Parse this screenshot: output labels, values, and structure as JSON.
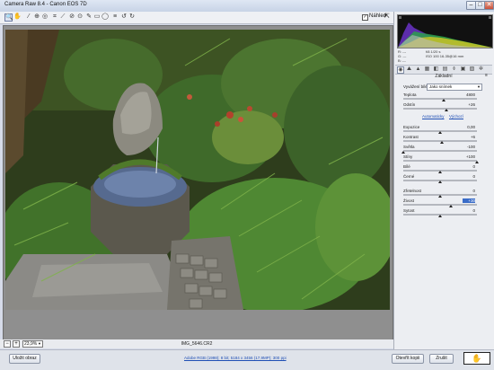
{
  "window": {
    "title": "Camera Raw 8.4  -  Canon EOS 7D"
  },
  "window_controls": {
    "minimize": "–",
    "maximize": "□",
    "close": "✕"
  },
  "toolbar": {
    "tools": [
      "zoom-icon",
      "hand-icon",
      "white-balance-icon",
      "color-sampler-icon",
      "targeted-adjustment-icon",
      "crop-icon",
      "straighten-icon",
      "spot-removal-icon",
      "red-eye-icon",
      "adjustment-brush-icon",
      "graduated-filter-icon",
      "radial-filter-icon",
      "preferences-icon",
      "rotate-left-icon",
      "rotate-right-icon"
    ],
    "tool_glyphs": [
      "🔍",
      "✋",
      "⁄",
      "⊕",
      "◎",
      "⌗",
      "⟋",
      "⊘",
      "⊙",
      "✎",
      "▭",
      "◯",
      "≡",
      "↺",
      "↻"
    ],
    "preview_checked": "✓",
    "preview_label": "Náhled",
    "fullscreen_glyph": "⇱"
  },
  "status": {
    "zoom": "23,9%",
    "filename": "IMG_5646.CR2"
  },
  "readouts": {
    "r": "R:  ---",
    "g": "G:  ---",
    "b": "B:  ---"
  },
  "exif": {
    "line1": "f/8    1/20 s",
    "line2": "ISO 100  16-35@16 mm"
  },
  "panel": {
    "tab_glyphs": [
      "◉",
      "⛰",
      "▲",
      "▦",
      "◧",
      "▤",
      "⌽",
      "▣",
      "▨",
      "✲"
    ],
    "section_title": "Základní",
    "section_menu": "≡",
    "wb_label": "Vyvážení bílé:",
    "wb_value": "Jako snímek",
    "links": {
      "auto": "Automaticky",
      "default": "Výchozí"
    },
    "sliders": [
      {
        "label": "Teplota",
        "value": "4800",
        "level": 0.55
      },
      {
        "label": "Odstín",
        "value": "+26",
        "level": 0.58
      },
      {
        "label": "Expozice",
        "value": "0,00",
        "level": 0.5
      },
      {
        "label": "Kontrast",
        "value": "+6",
        "level": 0.53
      },
      {
        "label": "Světla",
        "value": "-100",
        "level": 0.0
      },
      {
        "label": "Stíny",
        "value": "+100",
        "level": 1.0
      },
      {
        "label": "Bílé",
        "value": "0",
        "level": 0.5
      },
      {
        "label": "Černé",
        "value": "0",
        "level": 0.5
      },
      {
        "label": "Zřetelnost",
        "value": "0",
        "level": 0.5
      },
      {
        "label": "Živost",
        "value": "+30",
        "level": 0.65,
        "selected": true
      },
      {
        "label": "Sytost",
        "value": "0",
        "level": 0.5
      }
    ]
  },
  "bottom": {
    "save_label": "Uložit obraz",
    "workflow_link": "Adobe RGB (1998); 8 bit; 5184 x 3456 (17,9MP); 300 ppi",
    "open_label": "Otevřít kopii",
    "cancel_label": "Zrušit",
    "done_label": "Hotovo",
    "hand_glyph": "✋"
  }
}
